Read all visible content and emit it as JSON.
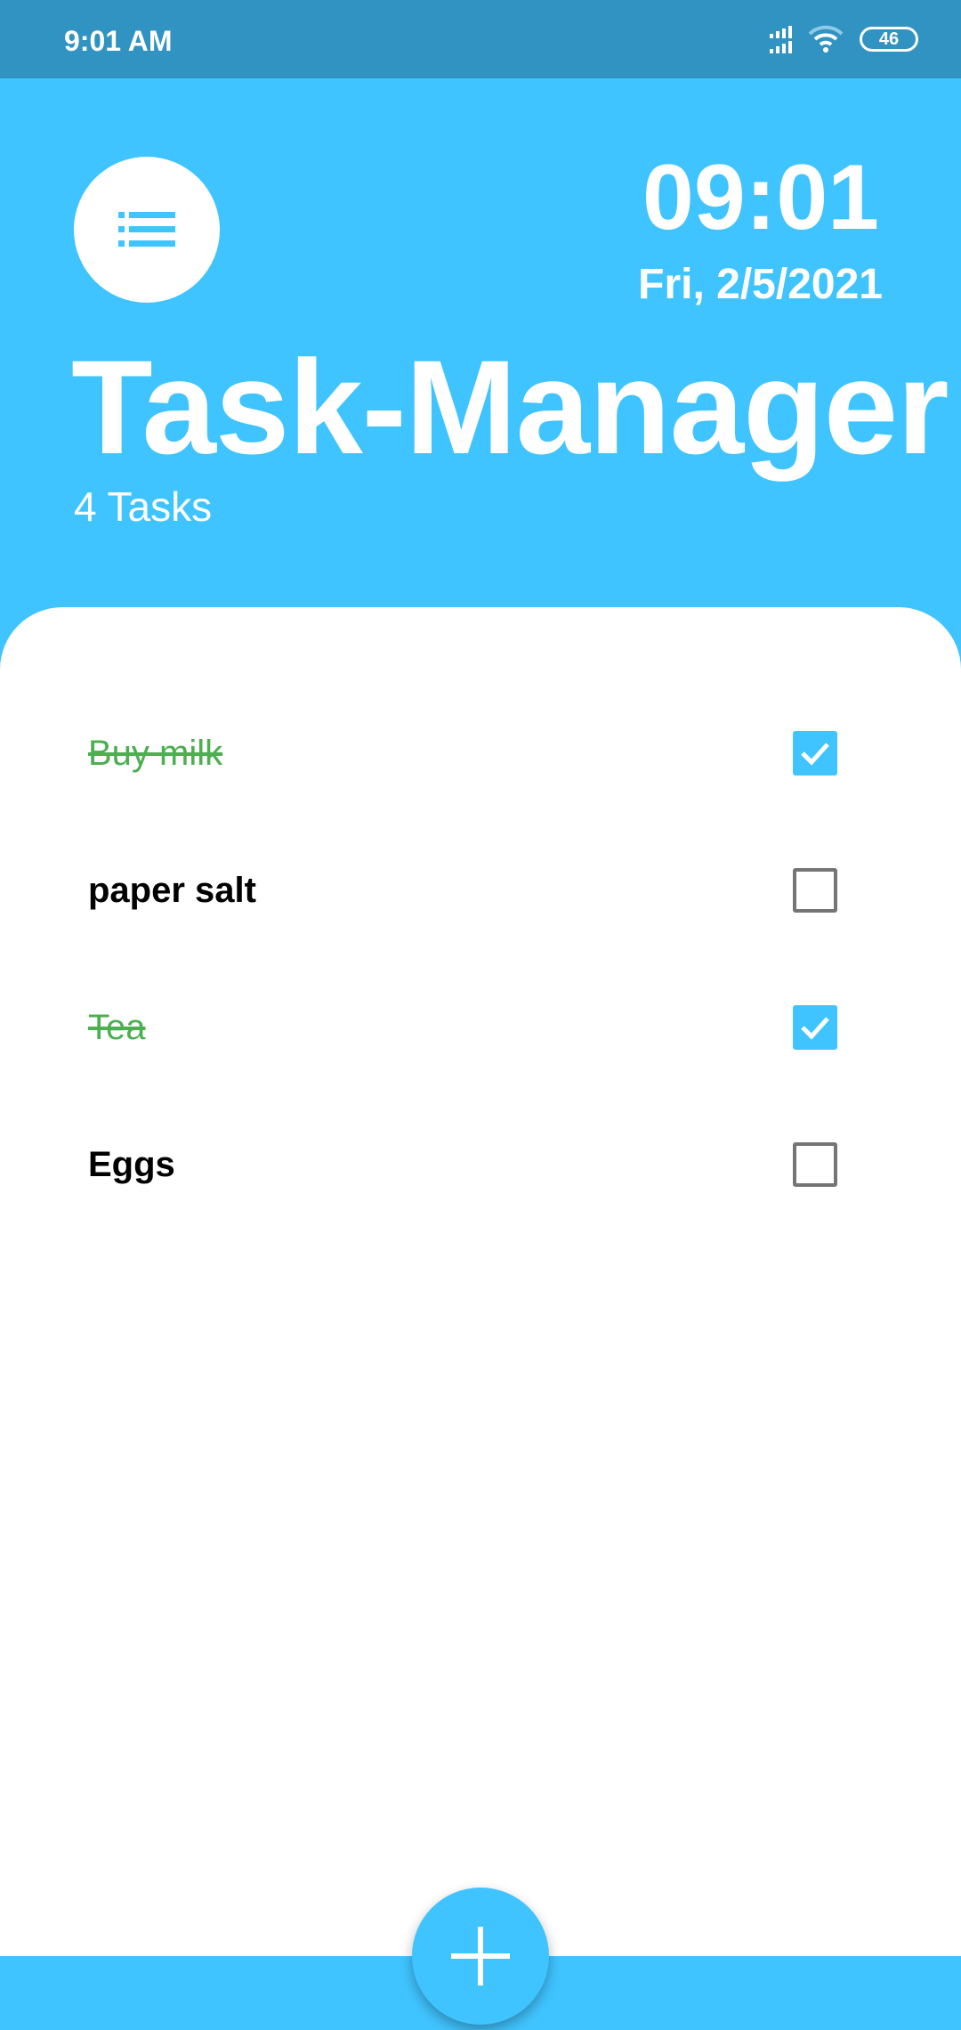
{
  "status_bar": {
    "time": "9:01 AM",
    "battery": "46"
  },
  "header": {
    "clock": "09:01",
    "date": "Fri, 2/5/2021",
    "title": "Task-Manager",
    "task_count": "4 Tasks"
  },
  "tasks": [
    {
      "label": "Buy milk",
      "done": true
    },
    {
      "label": "paper salt",
      "done": false
    },
    {
      "label": "Tea",
      "done": true
    },
    {
      "label": "Eggs",
      "done": false
    }
  ],
  "colors": {
    "accent": "#40c4ff",
    "status_bar": "#3193c1",
    "done_text": "#4caf50"
  }
}
